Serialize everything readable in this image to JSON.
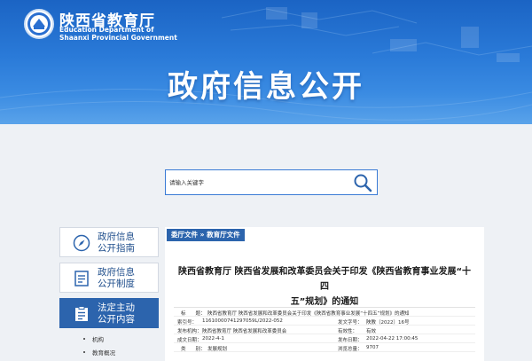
{
  "header": {
    "org_cn": "陕西省教育厅",
    "org_en_line1": "Education Department of",
    "org_en_line2": "Shaanxi Provincial Government",
    "banner_title": "政府信息公开"
  },
  "search": {
    "placeholder": "请输入关键字"
  },
  "sidebar": {
    "items": [
      {
        "line1": "政府信息",
        "line2": "公开指南",
        "icon": "compass-icon",
        "active": false
      },
      {
        "line1": "政府信息",
        "line2": "公开制度",
        "icon": "document-list-icon",
        "active": false
      },
      {
        "line1": "法定主动",
        "line2": "公开内容",
        "icon": "clipboard-icon",
        "active": true
      }
    ],
    "sub_items": [
      "机构",
      "教育概况"
    ]
  },
  "article": {
    "breadcrumb": "委厅文件 » 教育厅文件",
    "title_line1": "陕西省教育厅 陕西省发展和改革委员会关于印发《陕西省教育事业发展“十四",
    "title_line2": "五”规划》的通知",
    "meta": {
      "title_label": "标　　题：",
      "title_value": "陕西省教育厅 陕西省发展和改革委员会关于印发《陕西省教育事业发展“十四五”规划》的通知",
      "index_label": "索引号：",
      "index_value": "11610000741297059L/2022-052",
      "docno_label": "发文字号：",
      "docno_value": "陕教〔2022〕16号",
      "issuer_label": "发布机构：",
      "issuer_value": "陕西省教育厅 陕西省发展和改革委员会",
      "validity_label": "有效性：",
      "validity_value": "有效",
      "created_label": "成文日期：",
      "created_value": "2022-4-1",
      "published_label": "发布日期：",
      "published_value": "2022-04-22 17:00:45",
      "category_label": "类　　别：",
      "category_value": "发展规划",
      "views_label": "浏览总量：",
      "views_value": "9707"
    }
  }
}
